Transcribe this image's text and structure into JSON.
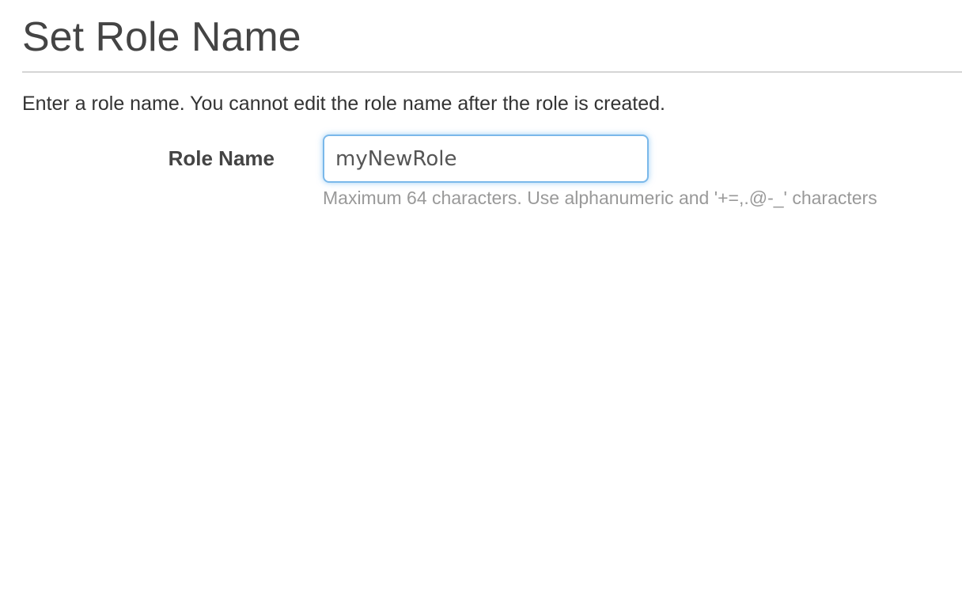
{
  "page": {
    "title": "Set Role Name",
    "description": "Enter a role name. You cannot edit the role name after the role is created."
  },
  "form": {
    "role_name_label": "Role Name",
    "role_name_value": "myNewRole",
    "role_name_hint": "Maximum 64 characters. Use alphanumeric and '+=,.@-_' characters"
  },
  "colors": {
    "focus_border": "#7ab8ea",
    "hint_text": "#999999",
    "title_text": "#444444"
  }
}
